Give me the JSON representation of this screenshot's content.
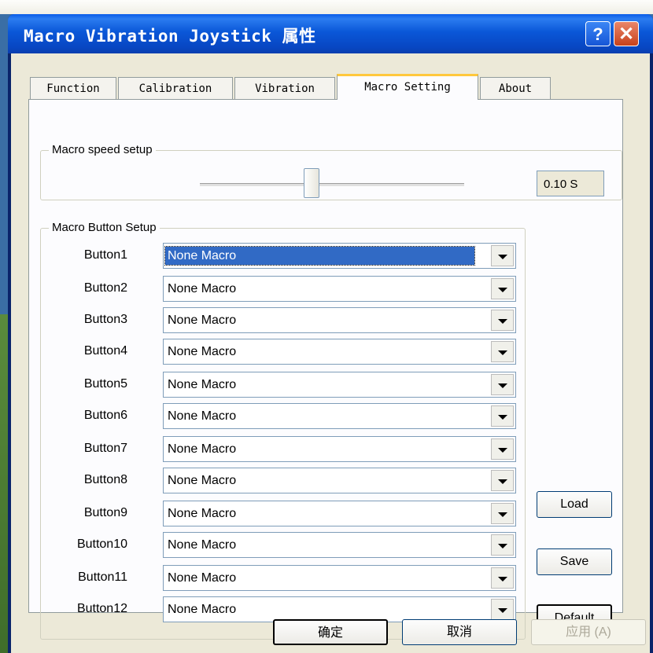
{
  "window": {
    "title": "Macro Vibration Joystick 属性",
    "help_label": "?",
    "close_label": "✕"
  },
  "tabs": [
    {
      "label": "Function",
      "active": false
    },
    {
      "label": "Calibration",
      "active": false
    },
    {
      "label": "Vibration",
      "active": false
    },
    {
      "label": "Macro Setting",
      "active": true
    },
    {
      "label": "About",
      "active": false
    }
  ],
  "speed": {
    "legend": "Macro speed setup",
    "value": "0.10 S"
  },
  "macro_buttons": {
    "legend": "Macro Button Setup",
    "rows": [
      {
        "label": "Button1",
        "value": "None Macro",
        "selected": true
      },
      {
        "label": "Button2",
        "value": "None Macro"
      },
      {
        "label": "Button3",
        "value": "None Macro"
      },
      {
        "label": "Button4",
        "value": "None Macro"
      },
      {
        "label": "Button5",
        "value": "None Macro"
      },
      {
        "label": "Button6",
        "value": "None Macro"
      },
      {
        "label": "Button7",
        "value": "None Macro"
      },
      {
        "label": "Button8",
        "value": "None Macro"
      },
      {
        "label": "Button9",
        "value": "None Macro"
      },
      {
        "label": "Button10",
        "value": "None Macro"
      },
      {
        "label": "Button11",
        "value": "None Macro"
      },
      {
        "label": "Button12",
        "value": "None Macro"
      }
    ]
  },
  "side_buttons": {
    "load": "Load",
    "save": "Save",
    "default": "Default"
  },
  "dialog_buttons": {
    "ok": "确定",
    "cancel": "取消",
    "apply": "应用 (A)"
  }
}
